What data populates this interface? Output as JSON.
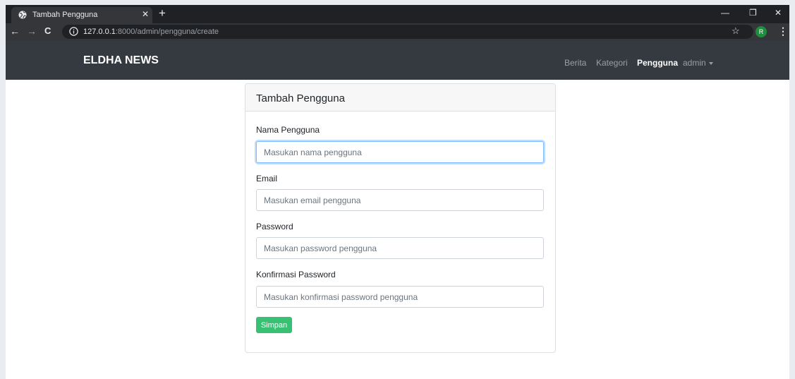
{
  "browser": {
    "tab_title": "Tambah Pengguna",
    "url_host": "127.0.0.1",
    "url_rest": ":8000/admin/pengguna/create",
    "profile_initial": "R"
  },
  "navbar": {
    "brand": "ELDHA NEWS",
    "links": [
      "Berita",
      "Kategori",
      "Pengguna",
      "admin"
    ],
    "active_link": "Pengguna"
  },
  "form": {
    "title": "Tambah Pengguna",
    "fields": [
      {
        "label": "Nama Pengguna",
        "placeholder": "Masukan nama pengguna",
        "value": ""
      },
      {
        "label": "Email",
        "placeholder": "Masukan email pengguna",
        "value": ""
      },
      {
        "label": "Password",
        "placeholder": "Masukan password pengguna",
        "value": ""
      },
      {
        "label": "Konfirmasi Password",
        "placeholder": "Masukan konfirmasi password pengguna",
        "value": ""
      }
    ],
    "submit_label": "Simpan"
  },
  "colors": {
    "navbar_bg": "#343a40",
    "submit_bg": "#38c172",
    "focus_border": "#80bdff"
  },
  "icons": [
    "globe-icon",
    "close-icon",
    "plus-icon",
    "minimize-icon",
    "restore-icon",
    "window-close-icon",
    "back-arrow-icon",
    "forward-arrow-icon",
    "reload-icon",
    "info-icon",
    "star-icon",
    "menu-dots-icon",
    "caret-down-icon"
  ]
}
